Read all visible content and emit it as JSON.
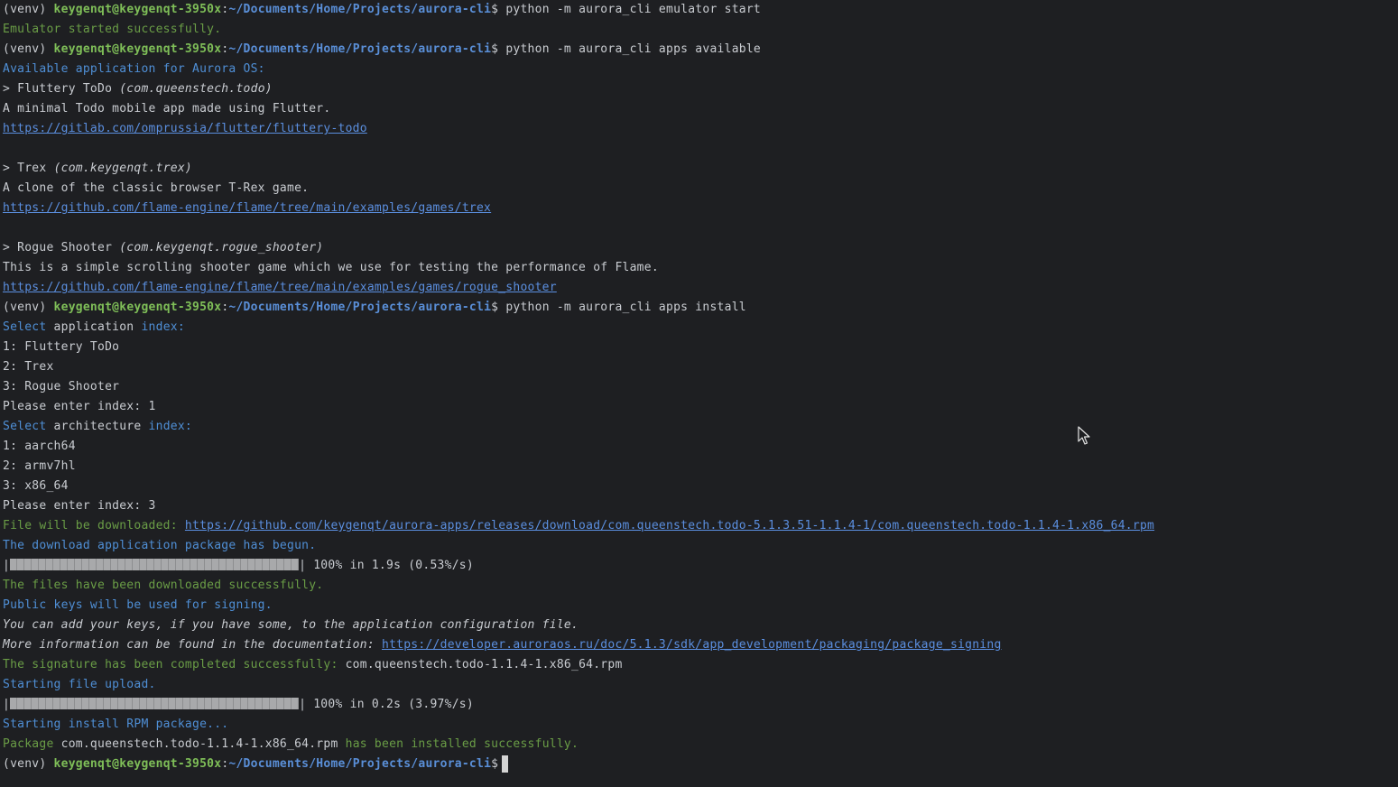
{
  "prompt": {
    "venv": "(venv) ",
    "user": "keygenqt@keygenqt-3950x",
    "colon": ":",
    "path": "~/Documents/Home/Projects/aurora-cli",
    "symbol": "$ "
  },
  "commands": {
    "c1": "python -m aurora_cli emulator start",
    "c2": "python -m aurora_cli apps available",
    "c3": "python -m aurora_cli apps install"
  },
  "output": {
    "emulator_started": "Emulator started successfully.",
    "available_title": "Available application for Aurora OS:",
    "app1_name": "> Fluttery ToDo ",
    "app1_id": "(com.queenstech.todo)",
    "app1_desc": "A minimal Todo mobile app made using Flutter.",
    "app1_url": "https://gitlab.com/omprussia/flutter/fluttery-todo",
    "app2_name": "> Trex ",
    "app2_id": "(com.keygenqt.trex)",
    "app2_desc": "A clone of the classic browser T-Rex game.",
    "app2_url": "https://github.com/flame-engine/flame/tree/main/examples/games/trex",
    "app3_name": "> Rogue Shooter ",
    "app3_id": "(com.keygenqt.rogue_shooter)",
    "app3_desc": "This is a simple scrolling shooter game which we use for testing the performance of Flame.",
    "app3_url": "https://github.com/flame-engine/flame/tree/main/examples/games/rogue_shooter",
    "select_word": "Select",
    "application_word": " application ",
    "index_word": "index:",
    "opt_app1": "1: Fluttery ToDo",
    "opt_app2": "2: Trex",
    "opt_app3": "3: Rogue Shooter",
    "enter_index_1": "Please enter index: 1",
    "architecture_word": " architecture ",
    "opt_arch1": "1: aarch64",
    "opt_arch2": "2: armv7hl",
    "opt_arch3": "3: x86_64",
    "enter_index_3": "Please enter index: 3",
    "download_label": "File will be downloaded: ",
    "download_url": "https://github.com/keygenqt/aurora-apps/releases/download/com.queenstech.todo-5.1.3.51-1.1.4-1/com.queenstech.todo-1.1.4-1.x86_64.rpm",
    "download_begun": "The download application package has begun.",
    "progress1_left": "|",
    "progress1_right": "| 100% in 1.9s (0.53%/s)",
    "downloaded_ok": "The files have been downloaded successfully.",
    "public_keys": "Public keys will be used for signing.",
    "add_keys": "You can add your keys, if you have some, to the application configuration file.",
    "more_info_label": "More information can be found in the documentation: ",
    "more_info_url": "https://developer.auroraos.ru/doc/5.1.3/sdk/app_development/packaging/package_signing",
    "signature_label": "The signature has been completed successfully: ",
    "signature_file": "com.queenstech.todo-1.1.4-1.x86_64.rpm",
    "starting_upload": "Starting file upload.",
    "progress2_left": "|",
    "progress2_right": "| 100% in 0.2s (3.97%/s)",
    "starting_install": "Starting install RPM package...",
    "package_word": "Package ",
    "package_file": "com.queenstech.todo-1.1.4-1.x86_64.rpm",
    "installed_ok": " has been installed successfully."
  },
  "progress": {
    "upload_download_fill": 1.0,
    "upload_file_fill": 1.0
  },
  "icons": {
    "mouse": "mouse-pointer-icon",
    "cursor": "terminal-cursor"
  },
  "colors": {
    "background": "#1e1f22",
    "user": "#7fbf58",
    "path": "#5a8fd8",
    "success": "#6a9d46",
    "info": "#4f8fd6",
    "link": "#5b8fe0"
  }
}
